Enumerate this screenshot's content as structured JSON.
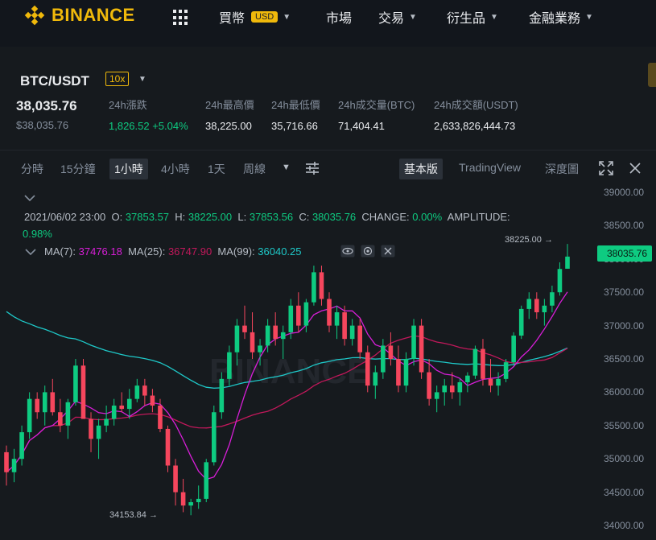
{
  "nav": {
    "brand": "BINANCE",
    "items": [
      {
        "label": "買幣",
        "badge": "USD",
        "caret": true
      },
      {
        "label": "市場",
        "caret": false
      },
      {
        "label": "交易",
        "caret": true
      },
      {
        "label": "衍生品",
        "caret": true
      },
      {
        "label": "金融業務",
        "caret": true
      }
    ]
  },
  "ticker": {
    "pair": "BTC/USDT",
    "leverage": "10x",
    "last_price": "38,035.76",
    "last_price_usd": "$38,035.76",
    "stats": [
      {
        "label": "24h漲跌",
        "value": "1,826.52 +5.04%",
        "color": "green"
      },
      {
        "label": "24h最高價",
        "value": "38,225.00"
      },
      {
        "label": "24h最低價",
        "value": "35,716.66"
      },
      {
        "label": "24h成交量(BTC)",
        "value": "71,404.41"
      },
      {
        "label": "24h成交額(USDT)",
        "value": "2,633,826,444.73"
      }
    ]
  },
  "toolbar": {
    "intervals": [
      "分時",
      "15分鐘",
      "1小時",
      "4小時",
      "1天",
      "周線"
    ],
    "active_interval": "1小時",
    "views": [
      "基本版",
      "TradingView",
      "深度圖"
    ],
    "active_view": "基本版"
  },
  "legend": {
    "datetime": "2021/06/02 23:00",
    "open_label": "O:",
    "open": "37853.57",
    "high_label": "H:",
    "high": "38225.00",
    "low_label": "L:",
    "low": "37853.56",
    "close_label": "C:",
    "close": "38035.76",
    "change_label": "CHANGE:",
    "change": "0.00%",
    "amplitude_label": "AMPLITUDE:",
    "amplitude": "0.98%",
    "ma7_label": "MA(7):",
    "ma7": "37476.18",
    "ma25_label": "MA(25):",
    "ma25": "36747.90",
    "ma99_label": "MA(99):",
    "ma99": "36040.25"
  },
  "colors": {
    "up": "#0ecb81",
    "down": "#f6465d",
    "ma7": "#d81ed8",
    "ma25": "#c2185b",
    "ma99": "#1ec8c8",
    "brand": "#f0b90b"
  },
  "chart_data": {
    "type": "candlestick",
    "watermark": "BINANCE",
    "y_ticks": [
      "39000.00",
      "38500.00",
      "38000.00",
      "37500.00",
      "37000.00",
      "36500.00",
      "36000.00",
      "35500.00",
      "35000.00",
      "34500.00",
      "34000.00"
    ],
    "ylim": [
      34000,
      39000
    ],
    "current_price_label": "38035.76",
    "high_marker": "38225.00",
    "low_marker": "34153.84",
    "candles": [
      [
        35100,
        35200,
        34600,
        34800
      ],
      [
        34800,
        35150,
        34650,
        35000
      ],
      [
        35000,
        35500,
        34900,
        35400
      ],
      [
        35400,
        36000,
        35300,
        35900
      ],
      [
        35900,
        36000,
        35600,
        35700
      ],
      [
        35700,
        36100,
        35500,
        36000
      ],
      [
        36000,
        36200,
        35650,
        35700
      ],
      [
        35700,
        35900,
        35400,
        35500
      ],
      [
        35500,
        35900,
        35300,
        35850
      ],
      [
        35850,
        36500,
        35800,
        36400
      ],
      [
        36400,
        36500,
        35600,
        35600
      ],
      [
        35600,
        35700,
        35100,
        35300
      ],
      [
        35300,
        35600,
        35000,
        35500
      ],
      [
        35500,
        35800,
        35400,
        35600
      ],
      [
        35600,
        35900,
        35500,
        35800
      ],
      [
        35800,
        36000,
        35700,
        35750
      ],
      [
        35750,
        36050,
        35600,
        35900
      ],
      [
        35900,
        36200,
        35850,
        36100
      ],
      [
        36100,
        36200,
        35800,
        35950
      ],
      [
        35950,
        36050,
        35700,
        35800
      ],
      [
        35800,
        35900,
        35400,
        35450
      ],
      [
        35450,
        35500,
        34800,
        34900
      ],
      [
        34900,
        35000,
        34300,
        34500
      ],
      [
        34500,
        34700,
        34200,
        34300
      ],
      [
        34300,
        34400,
        34154,
        34350
      ],
      [
        34350,
        34600,
        34250,
        34400
      ],
      [
        34400,
        35000,
        34350,
        34950
      ],
      [
        34950,
        35800,
        34900,
        35700
      ],
      [
        35700,
        36300,
        35600,
        36200
      ],
      [
        36200,
        36700,
        36100,
        36600
      ],
      [
        36600,
        37100,
        36400,
        37000
      ],
      [
        37000,
        37300,
        36800,
        36900
      ],
      [
        36900,
        37200,
        36500,
        36600
      ],
      [
        36600,
        36800,
        36400,
        36700
      ],
      [
        36700,
        37100,
        36600,
        37000
      ],
      [
        37000,
        37200,
        36700,
        36800
      ],
      [
        36800,
        37000,
        36500,
        36900
      ],
      [
        36900,
        37400,
        36800,
        37300
      ],
      [
        37300,
        37500,
        36900,
        37000
      ],
      [
        37000,
        37400,
        36900,
        37350
      ],
      [
        37350,
        37900,
        37300,
        37800
      ],
      [
        37800,
        37900,
        37300,
        37400
      ],
      [
        37400,
        37500,
        36900,
        37000
      ],
      [
        37000,
        37300,
        36800,
        37200
      ],
      [
        37200,
        37300,
        36700,
        36800
      ],
      [
        36800,
        37100,
        36700,
        37000
      ],
      [
        37000,
        37100,
        36500,
        36600
      ],
      [
        36600,
        36700,
        36000,
        36100
      ],
      [
        36100,
        36400,
        35900,
        36300
      ],
      [
        36300,
        36800,
        36200,
        36700
      ],
      [
        36700,
        36900,
        36400,
        36500
      ],
      [
        36500,
        36700,
        36000,
        36100
      ],
      [
        36100,
        36600,
        36000,
        36500
      ],
      [
        36500,
        37100,
        36400,
        37000
      ],
      [
        37000,
        37100,
        36200,
        36300
      ],
      [
        36300,
        36500,
        35800,
        35900
      ],
      [
        35900,
        36100,
        35700,
        36000
      ],
      [
        36000,
        36200,
        35800,
        36100
      ],
      [
        36100,
        36300,
        35900,
        36000
      ],
      [
        36000,
        36200,
        35800,
        36150
      ],
      [
        36150,
        36300,
        36000,
        36250
      ],
      [
        36250,
        36700,
        36200,
        36650
      ],
      [
        36650,
        36800,
        36100,
        36200
      ],
      [
        36200,
        36500,
        36000,
        36100
      ],
      [
        36100,
        36300,
        35950,
        36200
      ],
      [
        36200,
        36500,
        36150,
        36450
      ],
      [
        36450,
        36900,
        36400,
        36850
      ],
      [
        36850,
        37300,
        36800,
        37250
      ],
      [
        37250,
        37500,
        37100,
        37400
      ],
      [
        37400,
        37500,
        37100,
        37200
      ],
      [
        37200,
        37400,
        37000,
        37300
      ],
      [
        37300,
        37600,
        37200,
        37500
      ],
      [
        37500,
        37950,
        37450,
        37850
      ],
      [
        37853.57,
        38225,
        37853.56,
        38035.76
      ]
    ]
  }
}
